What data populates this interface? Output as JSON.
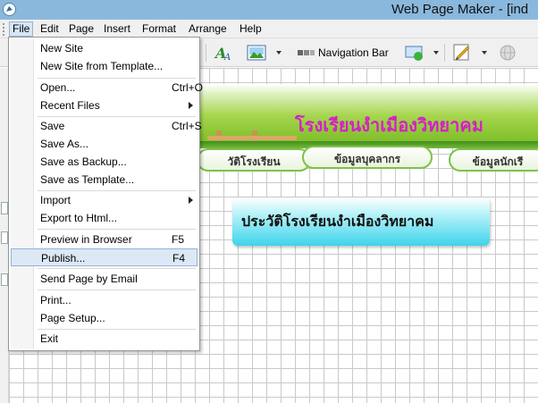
{
  "window": {
    "title": "Web Page Maker - [ind"
  },
  "menubar": {
    "items": [
      {
        "label": "File",
        "mnemonic": "F"
      },
      {
        "label": "Edit",
        "mnemonic": "E"
      },
      {
        "label": "Page",
        "mnemonic": "P"
      },
      {
        "label": "Insert",
        "mnemonic": "I"
      },
      {
        "label": "Format",
        "mnemonic": "m"
      },
      {
        "label": "Arrange",
        "mnemonic": "A"
      },
      {
        "label": "Help",
        "mnemonic": "H"
      }
    ]
  },
  "toolbar": {
    "navigation_bar_label": "Navigation Bar",
    "icons": [
      "text-style-icon",
      "insert-image-icon",
      "navigation-bar-icon",
      "insert-shape-icon",
      "edit-pen-icon",
      "preview-globe-icon"
    ]
  },
  "file_menu": {
    "items": [
      {
        "label": "New Site",
        "shortcut": "",
        "submenu": false
      },
      {
        "label": "New Site from Template...",
        "shortcut": "",
        "submenu": false
      },
      {
        "label": "Open...",
        "shortcut": "Ctrl+O",
        "submenu": false
      },
      {
        "label": "Recent Files",
        "shortcut": "",
        "submenu": true
      },
      {
        "label": "Save",
        "shortcut": "Ctrl+S",
        "submenu": false
      },
      {
        "label": "Save As...",
        "shortcut": "",
        "submenu": false
      },
      {
        "label": "Save as Backup...",
        "shortcut": "",
        "submenu": false
      },
      {
        "label": "Save as Template...",
        "shortcut": "",
        "submenu": false
      },
      {
        "label": "Import",
        "shortcut": "",
        "submenu": true
      },
      {
        "label": "Export to Html...",
        "shortcut": "",
        "submenu": false
      },
      {
        "label": "Preview in Browser",
        "shortcut": "F5",
        "submenu": false
      },
      {
        "label": "Publish...",
        "shortcut": "F4",
        "submenu": false,
        "highlighted": true
      },
      {
        "label": "Send Page by Email",
        "shortcut": "",
        "submenu": false
      },
      {
        "label": "Print...",
        "shortcut": "",
        "submenu": false
      },
      {
        "label": "Page Setup...",
        "shortcut": "",
        "submenu": false
      },
      {
        "label": "Exit",
        "shortcut": "",
        "submenu": false
      }
    ]
  },
  "canvas": {
    "banner_title": "โรงเรียนงำเมืองวิทยาคม",
    "nav_buttons": [
      "ประวัติโรงเรียน",
      "ข้อมูลบุคลากร",
      "ข้อมูลนักเรียน"
    ],
    "nav_button_visible": [
      "วัติโรงเรียน",
      "ข้อมูลบุคลากร",
      "ข้อมูลนักเรี"
    ],
    "text_box": "ประวัติโรงเรียนงำเมืองวิทยาคม"
  },
  "colors": {
    "titlebar": "#8ab8dd",
    "banner_title": "#d61ec8",
    "nav_border": "#7cc24a",
    "textbox_accent": "#3ed4ec",
    "menu_highlight": "#dce8f5"
  }
}
